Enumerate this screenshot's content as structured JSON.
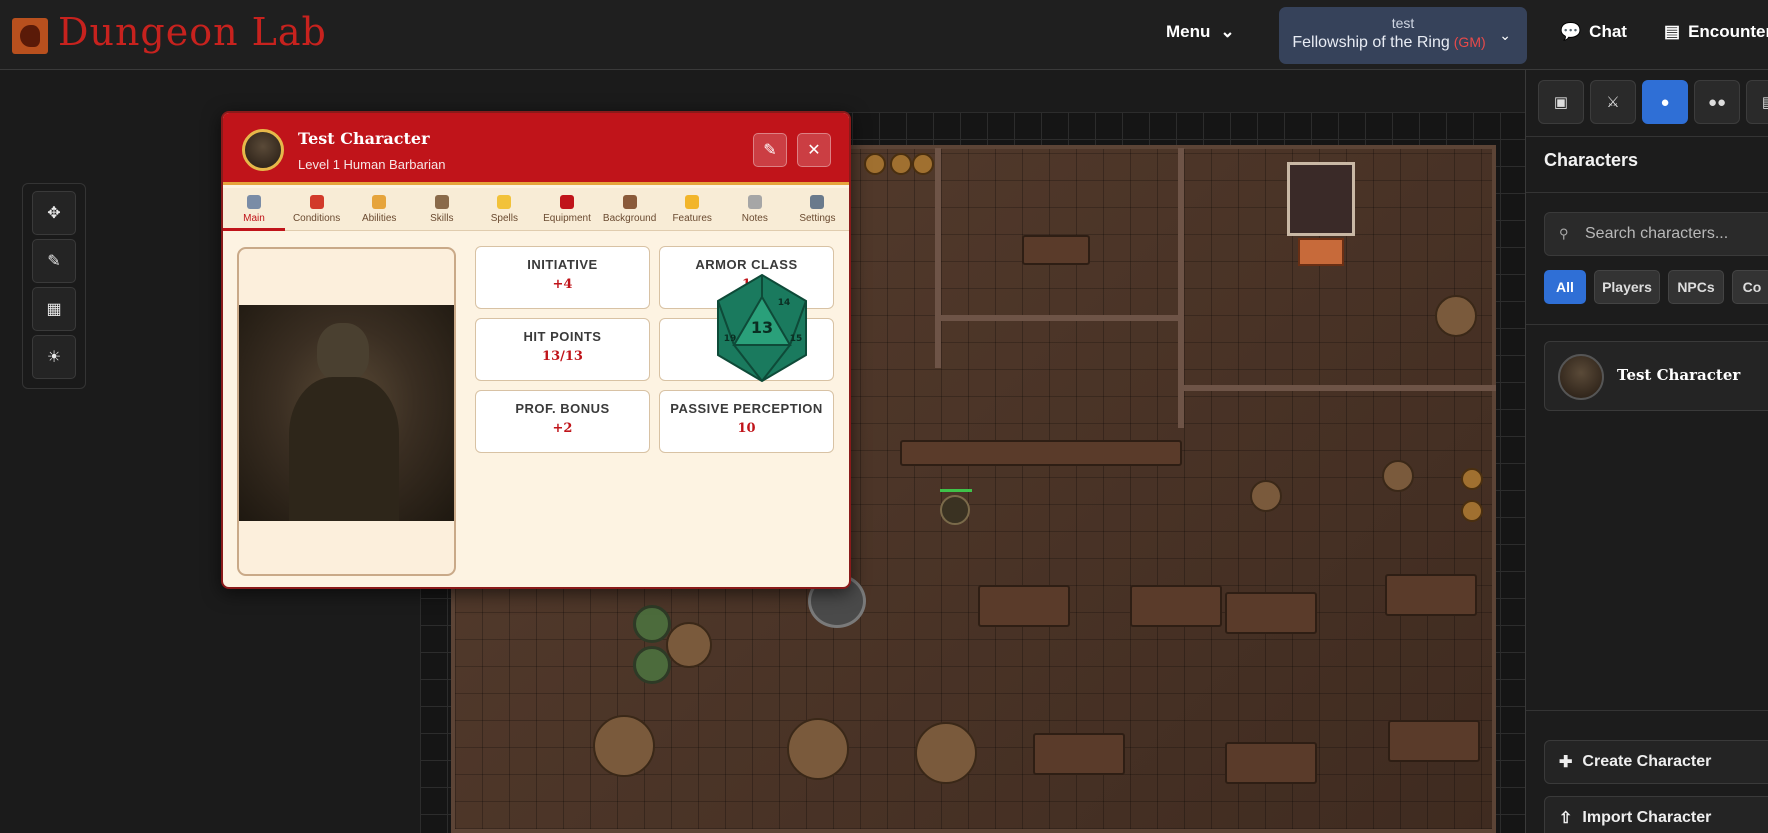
{
  "app": {
    "title": "Dungeon Lab"
  },
  "header": {
    "menu_label": "Menu",
    "campaign": {
      "subtitle": "test",
      "name": "Fellowship of the Ring",
      "role": "(GM)"
    },
    "chat_label": "Chat",
    "encounter_label": "Encounter"
  },
  "toolbar": {
    "tools": [
      "move-icon",
      "ruler-icon",
      "grid-icon",
      "light-icon"
    ]
  },
  "sheet": {
    "name": "Test Character",
    "subtitle": "Level 1 Human Barbarian",
    "tabs": [
      {
        "label": "Main",
        "icon": "scroll-icon",
        "color": "#7a8ca6"
      },
      {
        "label": "Conditions",
        "icon": "target-icon",
        "color": "#d23a2a"
      },
      {
        "label": "Abilities",
        "icon": "muscle-icon",
        "color": "#e6a43c"
      },
      {
        "label": "Skills",
        "icon": "bow-icon",
        "color": "#8a6a4a"
      },
      {
        "label": "Spells",
        "icon": "sparkle-icon",
        "color": "#f2c23a"
      },
      {
        "label": "Equipment",
        "icon": "backpack-icon",
        "color": "#c0141a"
      },
      {
        "label": "Background",
        "icon": "book-icon",
        "color": "#8a5a3a"
      },
      {
        "label": "Features",
        "icon": "star-icon",
        "color": "#f2b52a"
      },
      {
        "label": "Notes",
        "icon": "note-icon",
        "color": "#a6a6a6"
      },
      {
        "label": "Settings",
        "icon": "gear-icon",
        "color": "#6a7a8c"
      }
    ],
    "stats": [
      {
        "label": "INITIATIVE",
        "value": "+4"
      },
      {
        "label": "ARMOR CLASS",
        "value": "1"
      },
      {
        "label": "HIT POINTS",
        "value": "13/13"
      },
      {
        "label": "",
        "value": ""
      },
      {
        "label": "PROF. BONUS",
        "value": "+2"
      },
      {
        "label": "PASSIVE PERCEPTION",
        "value": "10"
      }
    ],
    "die": {
      "face": "13",
      "n1": "14",
      "n2": "15",
      "n3": "19",
      "color": "#1f8a6a"
    }
  },
  "right_panel": {
    "tabs": [
      "chat-icon",
      "combat-icon",
      "character-icon",
      "players-icon",
      "encounter-icon"
    ],
    "active_tab": 2,
    "title": "Characters",
    "search_placeholder": "Search characters...",
    "filters": [
      "All",
      "Players",
      "NPCs",
      "Co"
    ],
    "characters": [
      {
        "name": "Test Character"
      }
    ],
    "create_label": "Create Character",
    "import_label": "Import Character"
  }
}
